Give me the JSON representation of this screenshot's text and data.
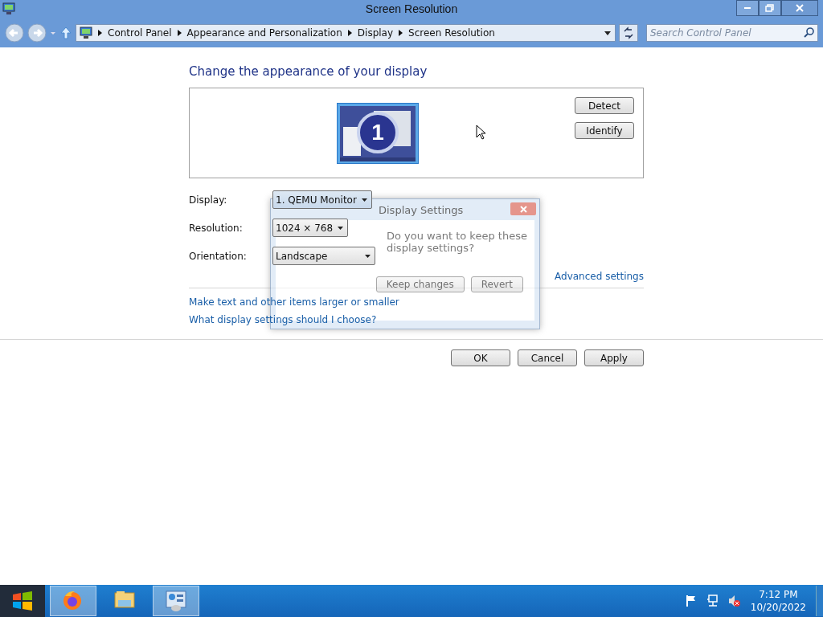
{
  "window": {
    "title": "Screen Resolution"
  },
  "nav": {
    "breadcrumb": [
      "Control Panel",
      "Appearance and Personalization",
      "Display",
      "Screen Resolution"
    ],
    "search": {
      "placeholder": "Search Control Panel"
    }
  },
  "heading": "Change the appearance of your display",
  "monitor": {
    "number": "1"
  },
  "side_buttons": [
    "Detect",
    "Identify"
  ],
  "form": [
    {
      "label": "Display:",
      "value": "1. QEMU Monitor"
    },
    {
      "label": "Resolution:",
      "value": "1024 × 768"
    },
    {
      "label": "Orientation:",
      "value": "Landscape"
    }
  ],
  "advanced_link": "Advanced settings",
  "links": [
    "Make text and other items larger or smaller",
    "What display settings should I choose?"
  ],
  "buttons": [
    "OK",
    "Cancel",
    "Apply"
  ],
  "dialog": {
    "title": "Display Settings",
    "message": "Do you want to keep these display settings?",
    "buttons": [
      "Keep changes",
      "Revert"
    ]
  },
  "taskbar": {
    "apps": [
      {
        "kind": "firefox",
        "active": true
      },
      {
        "kind": "explorer",
        "active": false
      },
      {
        "kind": "control-panel",
        "active": true
      }
    ],
    "time": "7:12 PM",
    "date": "10/20/2022"
  }
}
